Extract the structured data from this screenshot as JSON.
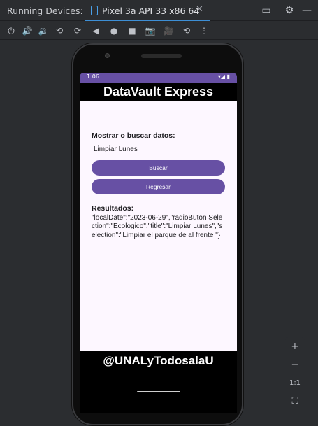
{
  "ide": {
    "panel_title": "Running Devices:",
    "tab_label": "Pixel 3a API 33 x86 64",
    "tab_close": "✕"
  },
  "window_buttons": {
    "restore": "▭",
    "settings": "⚙",
    "minimize": "—"
  },
  "toolbar_icons": [
    "power-icon",
    "volume-up-icon",
    "volume-down-icon",
    "rotate-left-icon",
    "rotate-right-icon",
    "back-icon",
    "home-icon",
    "overview-icon",
    "screenshot-icon",
    "record-icon",
    "snapshot-icon",
    "more-icon"
  ],
  "device": {
    "status_time": "1:06",
    "status_icons": "▾◢ ▮",
    "app_title": "DataVault Express",
    "form": {
      "label": "Mostrar o buscar datos:",
      "input_value": "Limpiar Lunes",
      "search_button": "Buscar",
      "back_button": "Regresar"
    },
    "results": {
      "label": "Resultados:",
      "text": "\"localDate\":\"2023-06-29\",\"radioButon Selection\":\"Ecologico\",\"title\":\"Limpiar Lunes\",\"selection\":\"Limpiar el parque de al frente \"}"
    },
    "footer_handle": "@UNALyTodosalaU"
  },
  "zoom": {
    "zoom_in": "+",
    "zoom_out": "−",
    "actual_size": "1:1",
    "fit": "⛶"
  }
}
